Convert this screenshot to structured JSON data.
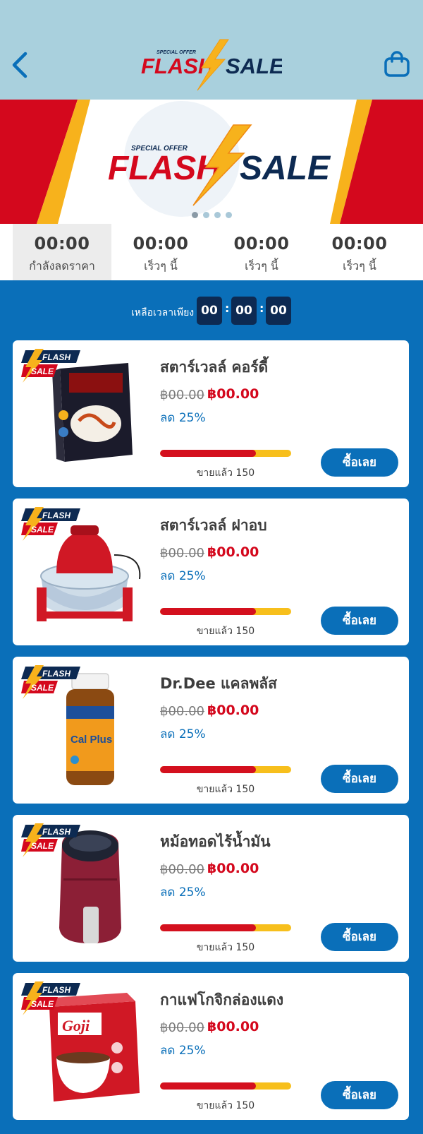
{
  "header": {
    "logo_top": "SPECIAL OFFER",
    "logo_left": "FLASH",
    "logo_right": "SALE"
  },
  "banner": {
    "offer": "SPECIAL OFFER",
    "left": "FLASH",
    "right": "SALE",
    "slide_count": 4,
    "active_slide": 0
  },
  "tabs": [
    {
      "time": "00:00",
      "label": "กำลังลดราคา",
      "active": true
    },
    {
      "time": "00:00",
      "label": "เร็วๆ นี้",
      "active": false
    },
    {
      "time": "00:00",
      "label": "เร็วๆ นี้",
      "active": false
    },
    {
      "time": "00:00",
      "label": "เร็วๆ นี้",
      "active": false
    }
  ],
  "countdown": {
    "label": "เหลือเวลาเพียง",
    "hours": "00",
    "minutes": "00",
    "seconds": "00"
  },
  "badge": {
    "top": "FLASH",
    "bottom": "SALE"
  },
  "products": [
    {
      "name": "สตาร์เวลล์ คอร์ดี้",
      "old_price": "฿00.00",
      "new_price": "฿00.00",
      "discount": "ลด 25%",
      "sold_label": "ขายแล้ว 150",
      "sold_fraction": 0.73,
      "buy_label": "ซื้อเลย",
      "image": "box-icon"
    },
    {
      "name": "สตาร์เวลล์ ฝาอบ",
      "old_price": "฿00.00",
      "new_price": "฿00.00",
      "discount": "ลด 25%",
      "sold_label": "ขายแล้ว 150",
      "sold_fraction": 0.73,
      "buy_label": "ซื้อเลย",
      "image": "halogen-oven-icon"
    },
    {
      "name": "Dr.Dee แคลพลัส",
      "old_price": "฿00.00",
      "new_price": "฿00.00",
      "discount": "ลด 25%",
      "sold_label": "ขายแล้ว 150",
      "sold_fraction": 0.73,
      "buy_label": "ซื้อเลย",
      "image": "bottle-icon"
    },
    {
      "name": "หม้อทอดไร้น้ำมัน",
      "old_price": "฿00.00",
      "new_price": "฿00.00",
      "discount": "ลด 25%",
      "sold_label": "ขายแล้ว 150",
      "sold_fraction": 0.73,
      "buy_label": "ซื้อเลย",
      "image": "air-fryer-icon"
    },
    {
      "name": "กาแฟโกจิกล่องแดง",
      "old_price": "฿00.00",
      "new_price": "฿00.00",
      "discount": "ลด 25%",
      "sold_label": "ขายแล้ว 150",
      "sold_fraction": 0.73,
      "buy_label": "ซื้อเลย",
      "image": "coffee-box-icon"
    }
  ],
  "colors": {
    "header_bg": "#a9d0dd",
    "page_bg": "#0a6fb9",
    "accent_red": "#d4081d",
    "accent_yellow": "#f7bf1c",
    "navy": "#0d2a52"
  }
}
